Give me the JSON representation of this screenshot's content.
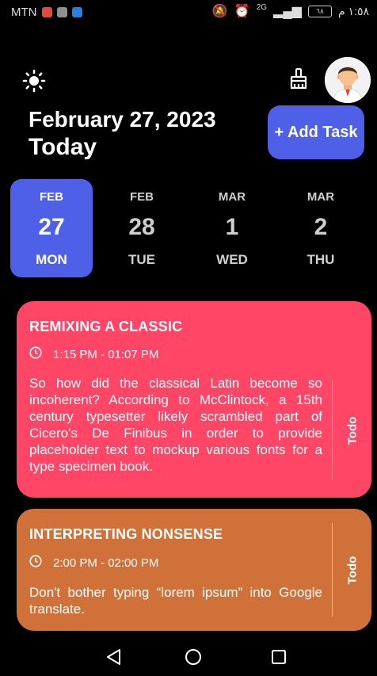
{
  "status_bar": {
    "carrier": "MTN",
    "network": "2G",
    "battery": "٦٨",
    "time": "١:٥٨ م",
    "notification_colors": [
      "#e64a3b",
      "#8f8f8f",
      "#2a7de1"
    ]
  },
  "header": {
    "date_title": "February 27, 2023",
    "day_title": "Today",
    "add_task_label": "+ Add Task"
  },
  "date_picker": [
    {
      "month": "FEB",
      "day": "27",
      "weekday": "MON",
      "selected": true
    },
    {
      "month": "FEB",
      "day": "28",
      "weekday": "TUE",
      "selected": false
    },
    {
      "month": "MAR",
      "day": "1",
      "weekday": "WED",
      "selected": false
    },
    {
      "month": "MAR",
      "day": "2",
      "weekday": "THU",
      "selected": false
    }
  ],
  "tasks": [
    {
      "title": "REMIXING A CLASSIC",
      "time": "1:15 PM - 01:07 PM",
      "description": "So how did the classical Latin become so incoherent? According to McClintock, a 15th century typesetter likely scrambled part of Cicero's De Finibus in order to provide placeholder text to mockup various fonts for a type specimen book.",
      "status": "Todo",
      "color": "#ff4667"
    },
    {
      "title": "INTERPRETING NONSENSE",
      "time": "2:00 PM - 02:00 PM",
      "description": "Don't bother typing “lorem ipsum” into Google translate.",
      "status": "Todo",
      "color": "#d0713a"
    }
  ],
  "colors": {
    "accent": "#4e5fe8",
    "background": "#000000"
  },
  "icons": {
    "theme_toggle": "sun-icon",
    "clear": "broom-icon",
    "profile": "avatar",
    "time": "clock-icon",
    "nav_back": "back-triangle-icon",
    "nav_home": "home-circle-icon",
    "nav_recents": "recents-square-icon"
  }
}
